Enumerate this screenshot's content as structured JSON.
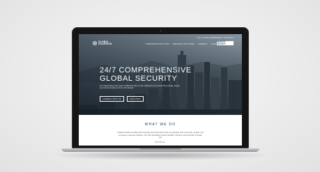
{
  "device": {
    "label": "MacBook"
  },
  "header": {
    "utility_link": "24/7 GLOBAL EMERGENCY SUPPORT",
    "logo_line1": "GLOBAL",
    "logo_line2": "GUARDIAN",
    "nav": [
      {
        "label": "CORPORATE SOLUTIONS"
      },
      {
        "label": "PERSONAL SOLUTIONS"
      },
      {
        "label": "INTERNAL"
      },
      {
        "label": "LOGIN"
      },
      {
        "label": "SUPPORT"
      }
    ],
    "cta_label": "REQUEST SECURITY"
  },
  "hero": {
    "headline_line1": "24/7 COMPREHENSIVE",
    "headline_line2": "GLOBAL SECURITY",
    "tagline": "For organizations who want to fulfill their duty of care obligations and protect their people, assets, and communication at home and abroad.",
    "buttons": [
      {
        "label": "CONNECT WITH US"
      },
      {
        "label": "OUR STORY"
      }
    ]
  },
  "section": {
    "title": "WHAT WE DO",
    "body": "Global Guardian provides both corporate and family clients with an integrated suite of security, medical, and emergency response solutions. Our 24/7 Operations Center identifies, monitors, and responds to threats and"
  },
  "colors": {
    "brand_navy": "#1c3a52",
    "cta_bg": "#ffffff",
    "bezel": "#151515"
  }
}
